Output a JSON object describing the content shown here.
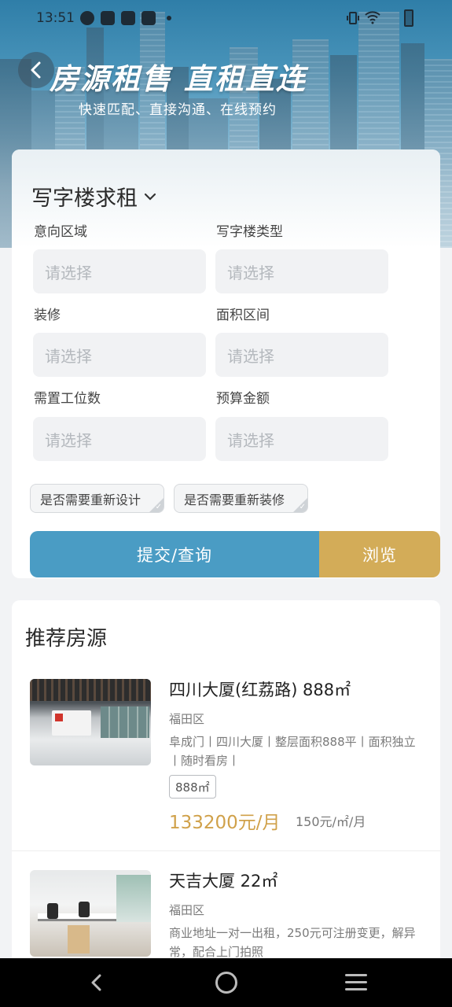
{
  "status_bar": {
    "time": "13:51"
  },
  "hero": {
    "title": "房源租售  直租直连",
    "subtitle": "快速匹配、直接沟通、在线预约"
  },
  "form": {
    "title": "写字楼求租",
    "fields": [
      {
        "label": "意向区域",
        "placeholder": "请选择"
      },
      {
        "label": "写字楼类型",
        "placeholder": "请选择"
      },
      {
        "label": "装修",
        "placeholder": "请选择"
      },
      {
        "label": "面积区间",
        "placeholder": "请选择"
      },
      {
        "label": "需置工位数",
        "placeholder": "请选择"
      },
      {
        "label": "预算金额",
        "placeholder": "请选择"
      }
    ],
    "chips": [
      "是否需要重新设计",
      "是否需要重新装修"
    ],
    "submit_label": "提交/查询",
    "browse_label": "浏览"
  },
  "recommend": {
    "title": "推荐房源",
    "listings": [
      {
        "name": "四川大厦(红荔路) 888㎡",
        "district": "福田区",
        "description": "阜成门丨四川大厦丨整层面积888平丨面积独立丨随时看房丨",
        "tag": "888㎡",
        "price": "133200元/月",
        "unit_price": "150元/㎡/月"
      },
      {
        "name": "天吉大厦 22㎡",
        "district": "福田区",
        "description": "商业地址一对一出租，250元可注册变更，解异常，配合上门拍照"
      }
    ]
  },
  "colors": {
    "accent_blue": "#4a9cc4",
    "accent_gold": "#d3ac58",
    "price_gold": "#d0a14a"
  }
}
